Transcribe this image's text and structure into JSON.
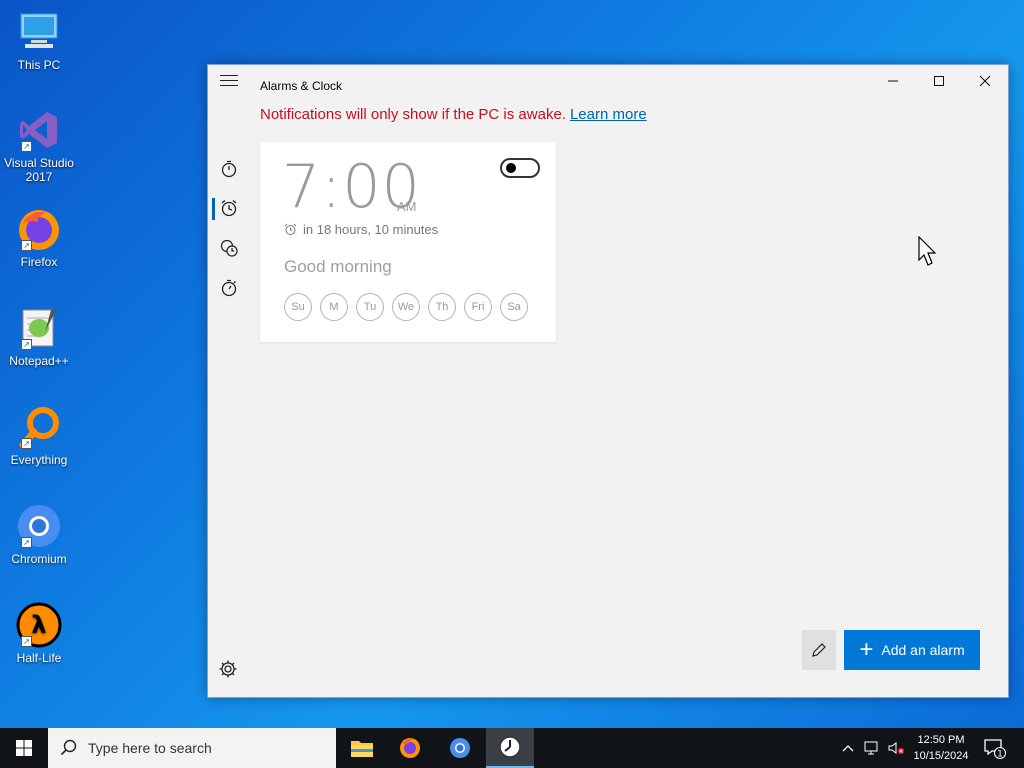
{
  "desktop": {
    "icons": [
      {
        "label": "This PC"
      },
      {
        "label": "Visual Studio 2017"
      },
      {
        "label": "Firefox"
      },
      {
        "label": "Notepad++"
      },
      {
        "label": "Everything"
      },
      {
        "label": "Chromium"
      },
      {
        "label": "Half-Life"
      }
    ]
  },
  "window": {
    "title": "Alarms & Clock",
    "notice": "Notifications will only show if the PC is awake.",
    "learn_more": "Learn more",
    "nav": [
      "timer-icon",
      "alarm-icon",
      "world-clock-icon",
      "stopwatch-icon"
    ],
    "alarm": {
      "time": "7:00",
      "ampm": "AM",
      "remaining": "in 18 hours, 10 minutes",
      "name": "Good morning",
      "enabled": false,
      "days": [
        "Su",
        "M",
        "Tu",
        "We",
        "Th",
        "Fri",
        "Sa"
      ]
    },
    "add_button": "Add an alarm"
  },
  "taskbar": {
    "search_placeholder": "Type here to search",
    "time": "12:50 PM",
    "date": "10/15/2024",
    "notification_count": "1"
  },
  "colors": {
    "accent": "#0078d7",
    "warning": "#c50f1f",
    "link": "#0063b1"
  }
}
